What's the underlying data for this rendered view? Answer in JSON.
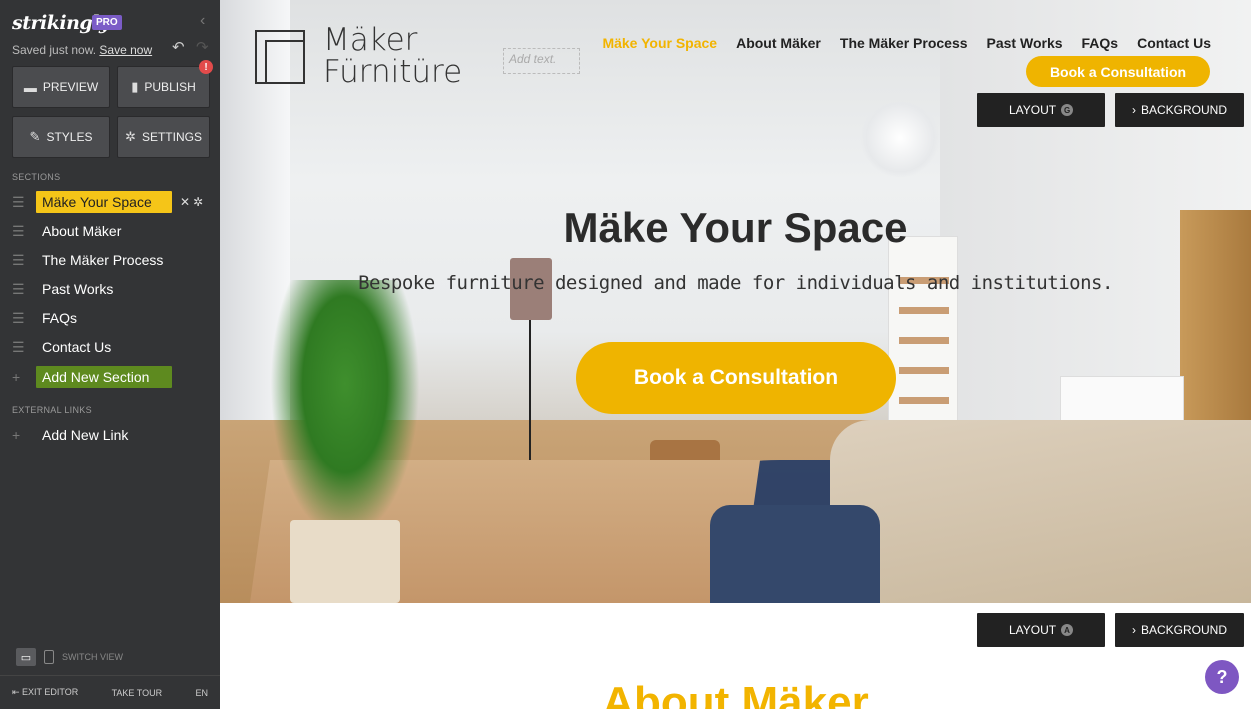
{
  "sidebar": {
    "logo": "strikingly",
    "pro_badge": "PRO",
    "saved_text": "Saved just now.",
    "save_now": "Save now",
    "buttons": {
      "preview": "PREVIEW",
      "publish": "PUBLISH",
      "styles": "STYLES",
      "settings": "SETTINGS"
    },
    "publish_alert": "!",
    "sections_label": "SECTIONS",
    "sections": [
      {
        "label": "Mäke Your Space"
      },
      {
        "label": "About Mäker"
      },
      {
        "label": "The Mäker Process"
      },
      {
        "label": "Past Works"
      },
      {
        "label": "FAQs"
      },
      {
        "label": "Contact Us"
      }
    ],
    "add_section": "Add New Section",
    "external_links_label": "EXTERNAL LINKS",
    "add_link": "Add New Link",
    "switch_view": "SWITCH VIEW",
    "exit_editor": "EXIT EDITOR",
    "take_tour": "TAKE TOUR",
    "language": "EN"
  },
  "site": {
    "brand_line1": "Mäker",
    "brand_line2": "Fürnitüre",
    "add_text_placeholder": "Add text.",
    "nav": [
      "Mäke Your Space",
      "About Mäker",
      "The Mäker Process",
      "Past Works",
      "FAQs",
      "Contact Us"
    ],
    "nav_cta": "Book a Consultation",
    "hero_title": "Mäke Your Space",
    "hero_subtitle": "Bespoke furniture designed and made for individuals and institutions.",
    "hero_cta": "Book a Consultation",
    "next_section_title": "About Mäker"
  },
  "editor_tools": {
    "layout": "LAYOUT",
    "layout_key_top": "G",
    "layout_key_bottom": "A",
    "background": "BACKGROUND"
  },
  "help": "?",
  "colors": {
    "accent": "#efb400",
    "sidebar_bg": "#333436",
    "active_section": "#f5c518",
    "add_section": "#5e8a1f",
    "help": "#7e57c2"
  }
}
